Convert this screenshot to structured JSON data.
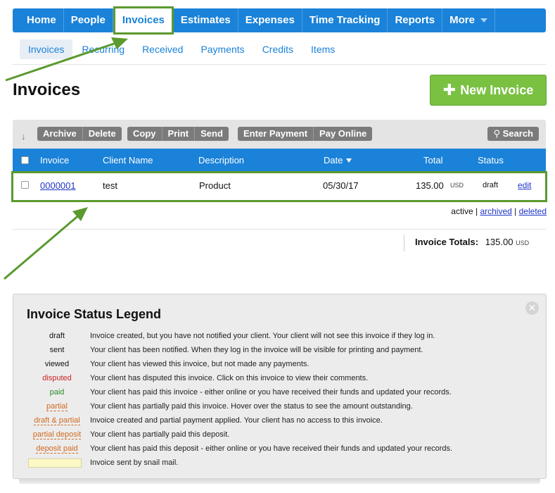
{
  "topnav": {
    "items": [
      {
        "label": "Home"
      },
      {
        "label": "People"
      },
      {
        "label": "Invoices",
        "active": true
      },
      {
        "label": "Estimates"
      },
      {
        "label": "Expenses"
      },
      {
        "label": "Time Tracking"
      },
      {
        "label": "Reports"
      },
      {
        "label": "More"
      }
    ]
  },
  "subnav": {
    "items": [
      {
        "label": "Invoices",
        "active": true
      },
      {
        "label": "Recurring"
      },
      {
        "label": "Received"
      },
      {
        "label": "Payments"
      },
      {
        "label": "Credits"
      },
      {
        "label": "Items"
      }
    ]
  },
  "page": {
    "title": "Invoices",
    "new_invoice_label": "New Invoice"
  },
  "toolbar": {
    "archive": "Archive",
    "delete": "Delete",
    "copy": "Copy",
    "print": "Print",
    "send": "Send",
    "enter_payment": "Enter Payment",
    "pay_online": "Pay Online",
    "search": "Search"
  },
  "table": {
    "headers": {
      "invoice": "Invoice",
      "client": "Client Name",
      "description": "Description",
      "date": "Date",
      "total": "Total",
      "status": "Status"
    },
    "rows": [
      {
        "invoice": "0000001",
        "client": "test",
        "description": "Product",
        "date": "05/30/17",
        "total": "135.00",
        "currency": "USD",
        "status": "draft",
        "action": "edit"
      }
    ]
  },
  "filters": {
    "active": "active",
    "sep": "|",
    "archived": "archived",
    "deleted": "deleted"
  },
  "totals": {
    "label": "Invoice Totals:",
    "value": "135.00",
    "currency": "USD"
  },
  "legend": {
    "title": "Invoice Status Legend",
    "items": [
      {
        "term": "draft",
        "color": "#111111",
        "desc": "Invoice created, but you have not notified your client. Your client will not see this invoice if they log in."
      },
      {
        "term": "sent",
        "color": "#111111",
        "desc": "Your client has been notified. When they log in the invoice will be visible for printing and payment."
      },
      {
        "term": "viewed",
        "color": "#111111",
        "desc": "Your client has viewed this invoice, but not made any payments."
      },
      {
        "term": "disputed",
        "color": "#cc2222",
        "desc": "Your client has disputed this invoice. Click on this invoice to view their comments."
      },
      {
        "term": "paid",
        "color": "#2a8a2a",
        "desc": "Your client has paid this invoice - either online or you have received their funds and updated your records."
      },
      {
        "term": "partial",
        "color": "#d2691e",
        "desc": "Your client has partially paid this invoice. Hover over the status to see the amount outstanding."
      },
      {
        "term": "draft & partial",
        "color": "#d2691e",
        "desc": "Invoice created and partial payment applied. Your client has no access to this invoice."
      },
      {
        "term": "partial deposit",
        "color": "#d2691e",
        "desc": "Your client has partially paid this deposit."
      },
      {
        "term": "deposit paid",
        "color": "#d2691e",
        "desc": "Your client has paid this deposit - either online or you have received their funds and updated your records."
      },
      {
        "term": "",
        "color": "#fdf9c6",
        "desc": "Invoice sent by snail mail."
      }
    ]
  }
}
